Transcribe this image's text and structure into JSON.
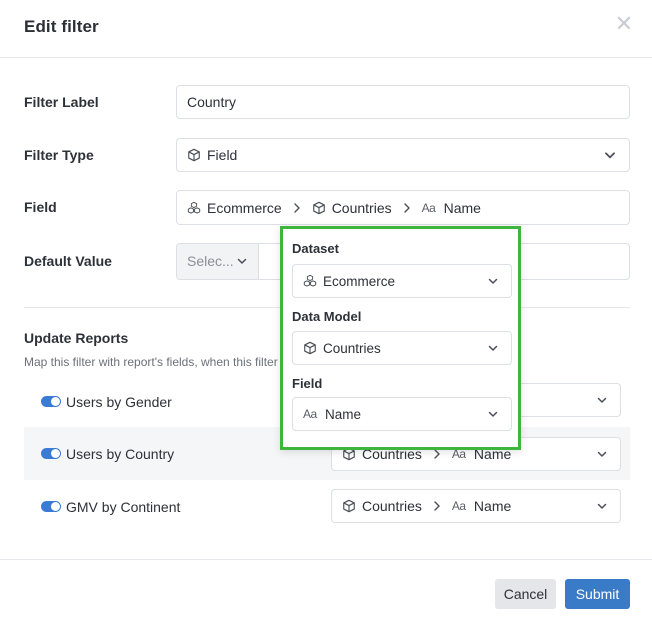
{
  "header": {
    "title": "Edit filter",
    "close_icon": "close-icon"
  },
  "form": {
    "filter_label": {
      "label": "Filter Label",
      "value": "Country"
    },
    "filter_type": {
      "label": "Filter Type",
      "value": "Field",
      "icon": "cube-icon"
    },
    "field": {
      "label": "Field",
      "path": [
        {
          "text": "Ecommerce",
          "icon": "dataset-icon"
        },
        {
          "text": "Countries",
          "icon": "cube-icon"
        },
        {
          "text": "Name",
          "icon": "text-type-icon",
          "type_glyph": "Aa"
        }
      ]
    },
    "default_value": {
      "label": "Default Value",
      "select_placeholder": "Selec..."
    }
  },
  "reports": {
    "title": "Update Reports",
    "subtitle": "Map this filter with report's fields, when this filter c",
    "items": [
      {
        "name": "Users by Gender",
        "enabled": true,
        "model": "",
        "field": ""
      },
      {
        "name": "Users by Country",
        "enabled": true,
        "model": "Countries",
        "field": "Name"
      },
      {
        "name": "GMV by Continent",
        "enabled": true,
        "model": "Countries",
        "field": "Name"
      }
    ]
  },
  "popover": {
    "dataset": {
      "label": "Dataset",
      "value": "Ecommerce"
    },
    "data_model": {
      "label": "Data Model",
      "value": "Countries"
    },
    "field": {
      "label": "Field",
      "value": "Name",
      "type_glyph": "Aa"
    },
    "highlight_color": "#3eb53c"
  },
  "footer": {
    "cancel_label": "Cancel",
    "submit_label": "Submit"
  },
  "colors": {
    "accent": "#3a7bc8",
    "toggle": "#3a7bd5",
    "cancel_bg": "#e4e6e9"
  }
}
